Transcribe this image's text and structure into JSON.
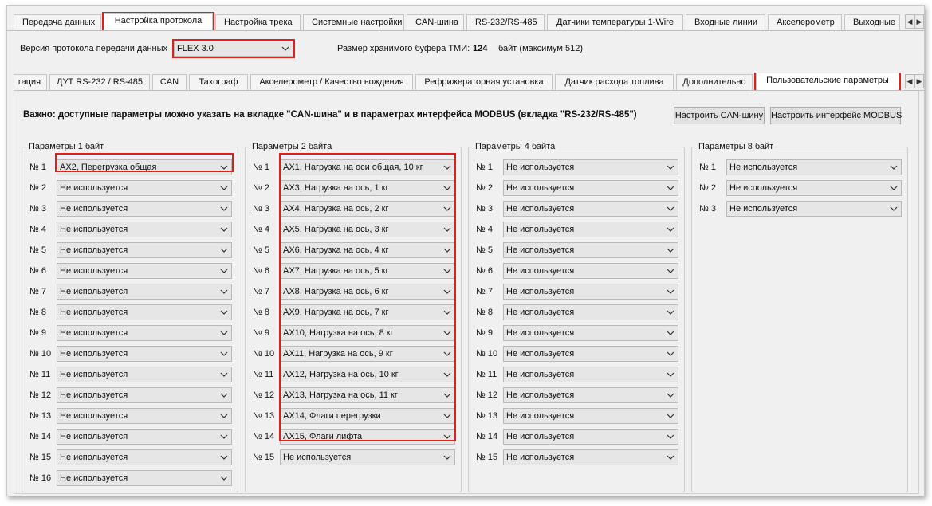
{
  "top_tabs": [
    {
      "label": "Передача данных",
      "active": false
    },
    {
      "label": "Настройка протокола",
      "active": true
    },
    {
      "label": "Настройка трека",
      "active": false
    },
    {
      "label": "Системные настройки",
      "active": false
    },
    {
      "label": "CAN-шина",
      "active": false
    },
    {
      "label": "RS-232/RS-485",
      "active": false
    },
    {
      "label": "Датчики температуры 1-Wire",
      "active": false
    },
    {
      "label": "Входные линии",
      "active": false
    },
    {
      "label": "Акселерометр",
      "active": false
    },
    {
      "label": "Выходные",
      "active": false
    }
  ],
  "protocol": {
    "version_label": "Версия протокола передачи данных",
    "version_value": "FLEX 3.0",
    "buffer_label": "Размер хранимого буфера ТМИ:",
    "buffer_value": "124",
    "buffer_suffix": "байт (максимум 512)"
  },
  "sub_tabs": [
    {
      "label": "гация",
      "active": false
    },
    {
      "label": "ДУТ RS-232 / RS-485",
      "active": false
    },
    {
      "label": "CAN",
      "active": false
    },
    {
      "label": "Тахограф",
      "active": false
    },
    {
      "label": "Акселерометр / Качество вождения",
      "active": false
    },
    {
      "label": "Рефрижераторная установка",
      "active": false
    },
    {
      "label": "Датчик расхода топлива",
      "active": false
    },
    {
      "label": "Дополнительно",
      "active": false
    },
    {
      "label": "Пользовательские параметры",
      "active": true
    }
  ],
  "notice": "Важно: доступные параметры можно указать на вкладке \"CAN-шина\" и в параметрах интерфейса MODBUS (вкладка \"RS-232/RS-485\")",
  "buttons": {
    "can_setup": "Настроить CAN-шину",
    "modbus_setup": "Настроить интерфейс MODBUS"
  },
  "groups": [
    {
      "title": "Параметры 1 байт",
      "rows": [
        {
          "num": "№ 1",
          "value": "AX2, Перегрузка общая"
        },
        {
          "num": "№ 2",
          "value": "Не используется"
        },
        {
          "num": "№ 3",
          "value": "Не используется"
        },
        {
          "num": "№ 4",
          "value": "Не используется"
        },
        {
          "num": "№ 5",
          "value": "Не используется"
        },
        {
          "num": "№ 6",
          "value": "Не используется"
        },
        {
          "num": "№ 7",
          "value": "Не используется"
        },
        {
          "num": "№ 8",
          "value": "Не используется"
        },
        {
          "num": "№ 9",
          "value": "Не используется"
        },
        {
          "num": "№ 10",
          "value": "Не используется"
        },
        {
          "num": "№ 11",
          "value": "Не используется"
        },
        {
          "num": "№ 12",
          "value": "Не используется"
        },
        {
          "num": "№ 13",
          "value": "Не используется"
        },
        {
          "num": "№ 14",
          "value": "Не используется"
        },
        {
          "num": "№ 15",
          "value": "Не используется"
        },
        {
          "num": "№ 16",
          "value": "Не используется"
        }
      ]
    },
    {
      "title": "Параметры 2 байта",
      "rows": [
        {
          "num": "№ 1",
          "value": "AX1, Нагрузка на оси общая, 10 кг"
        },
        {
          "num": "№ 2",
          "value": "AX3, Нагрузка на ось, 1 кг"
        },
        {
          "num": "№ 3",
          "value": "AX4, Нагрузка на ось, 2 кг"
        },
        {
          "num": "№ 4",
          "value": "AX5, Нагрузка на ось, 3 кг"
        },
        {
          "num": "№ 5",
          "value": "AX6, Нагрузка на ось, 4 кг"
        },
        {
          "num": "№ 6",
          "value": "AX7, Нагрузка на ось, 5 кг"
        },
        {
          "num": "№ 7",
          "value": "AX8, Нагрузка на ось, 6 кг"
        },
        {
          "num": "№ 8",
          "value": "AX9, Нагрузка на ось, 7 кг"
        },
        {
          "num": "№ 9",
          "value": "AX10, Нагрузка на ось, 8 кг"
        },
        {
          "num": "№ 10",
          "value": "AX11, Нагрузка на ось, 9 кг"
        },
        {
          "num": "№ 11",
          "value": "AX12, Нагрузка на ось, 10 кг"
        },
        {
          "num": "№ 12",
          "value": "AX13, Нагрузка на ось, 11 кг"
        },
        {
          "num": "№ 13",
          "value": "AX14, Флаги перегрузки"
        },
        {
          "num": "№ 14",
          "value": "AX15, Флаги лифта"
        },
        {
          "num": "№ 15",
          "value": "Не используется"
        }
      ]
    },
    {
      "title": "Параметры 4 байта",
      "rows": [
        {
          "num": "№ 1",
          "value": "Не используется"
        },
        {
          "num": "№ 2",
          "value": "Не используется"
        },
        {
          "num": "№ 3",
          "value": "Не используется"
        },
        {
          "num": "№ 4",
          "value": "Не используется"
        },
        {
          "num": "№ 5",
          "value": "Не используется"
        },
        {
          "num": "№ 6",
          "value": "Не используется"
        },
        {
          "num": "№ 7",
          "value": "Не используется"
        },
        {
          "num": "№ 8",
          "value": "Не используется"
        },
        {
          "num": "№ 9",
          "value": "Не используется"
        },
        {
          "num": "№ 10",
          "value": "Не используется"
        },
        {
          "num": "№ 11",
          "value": "Не используется"
        },
        {
          "num": "№ 12",
          "value": "Не используется"
        },
        {
          "num": "№ 13",
          "value": "Не используется"
        },
        {
          "num": "№ 14",
          "value": "Не используется"
        },
        {
          "num": "№ 15",
          "value": "Не используется"
        }
      ]
    },
    {
      "title": "Параметры 8 байт",
      "rows": [
        {
          "num": "№ 1",
          "value": "Не используется"
        },
        {
          "num": "№ 2",
          "value": "Не используется"
        },
        {
          "num": "№ 3",
          "value": "Не используется"
        }
      ]
    }
  ],
  "colors": {
    "highlight": "#e01f1f",
    "window_bg": "#f0f0f0",
    "combo_bg": "#e6e6e6"
  },
  "icons": {
    "dropdown": "chevron-down-icon",
    "scroll_left": "scroll-left-icon",
    "scroll_right": "scroll-right-icon"
  }
}
